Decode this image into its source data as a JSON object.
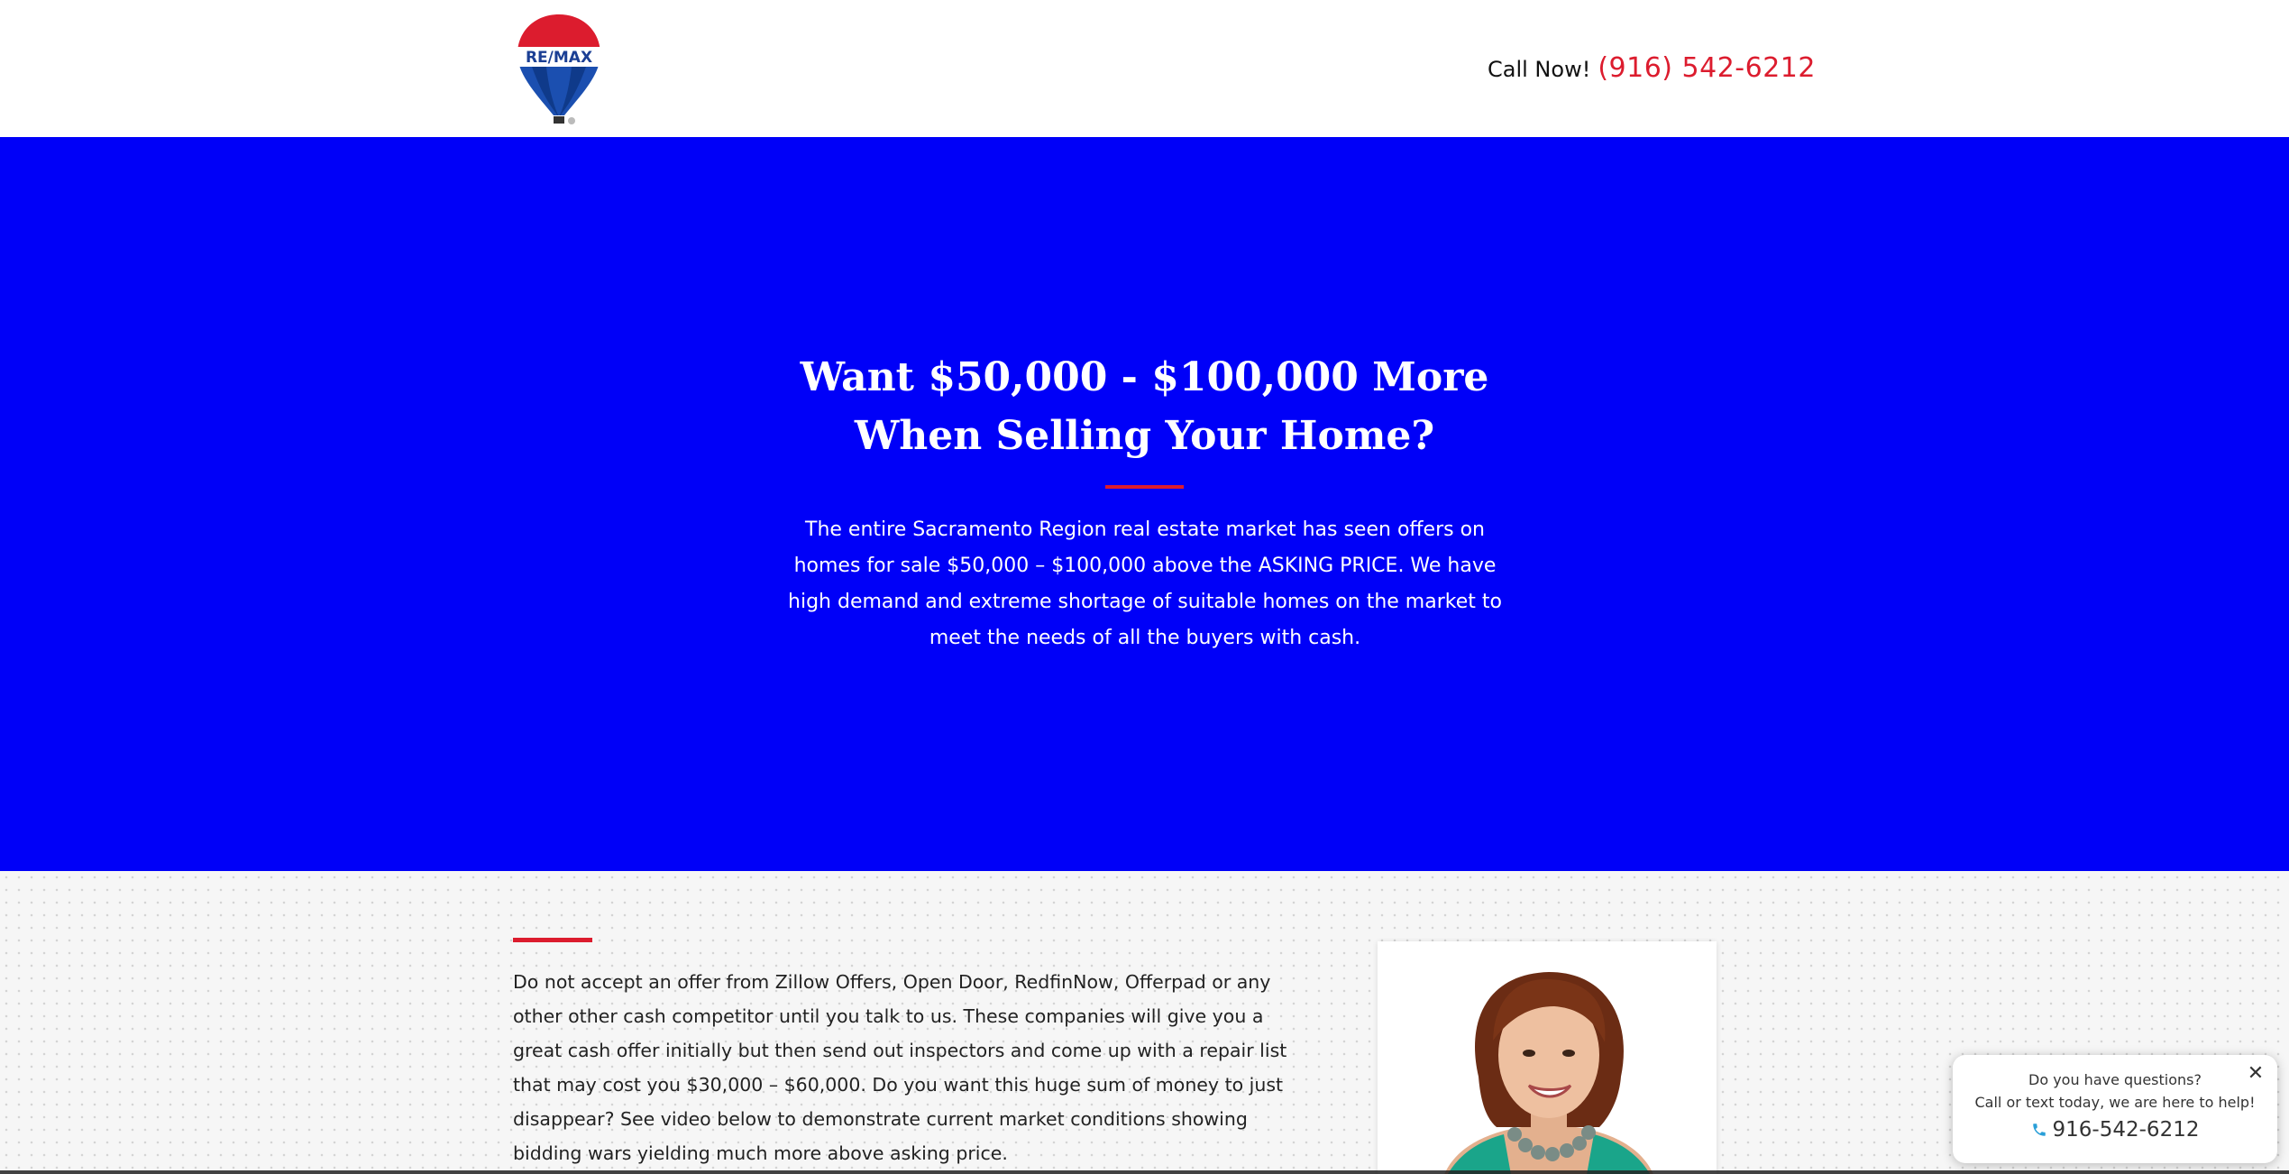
{
  "header": {
    "logo_text": "RE/MAX",
    "call_label": "Call Now!",
    "call_phone": "(916) 542-6212"
  },
  "hero": {
    "title_line1": "Want $50,000 - $100,000 More",
    "title_line2": "When Selling Your Home?",
    "body": "The entire Sacramento Region real estate market has seen offers on homes for sale $50,000 – $100,000 above the ASKING PRICE. We have high demand and extreme shortage of suitable homes on the market to meet the needs of all the buyers with cash."
  },
  "content": {
    "paragraph": "Do not accept an offer from Zillow Offers, Open Door, RedfinNow, Offerpad or any other other cash competitor until you talk to us. These companies will give you a great cash offer initially but then send out inspectors and come up with a repair list that may cost you $30,000 – $60,000. Do you want this huge sum of money to just disappear? See video below to demonstrate current market conditions showing bidding wars yielding much more above asking price."
  },
  "chat": {
    "question": "Do you have questions?",
    "subtitle": "Call or text today, we are here to help!",
    "phone": "916-542-6212",
    "close_symbol": "✕"
  },
  "colors": {
    "hero_blue": "#0000f8",
    "accent_red": "#dc1c2e"
  },
  "icons": [
    "remax-balloon-logo",
    "close-icon",
    "phone-icon"
  ]
}
